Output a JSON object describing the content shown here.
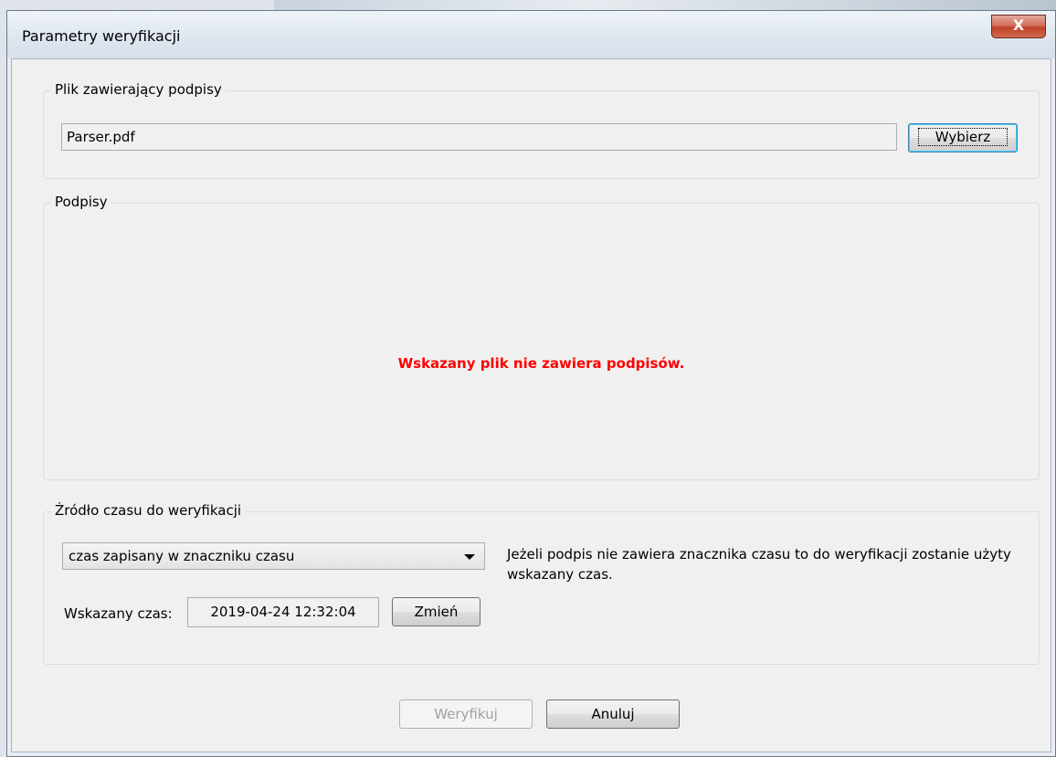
{
  "window": {
    "title": "Parametry weryfikacji",
    "close_symbol": "X"
  },
  "file_group": {
    "label": "Plik zawierający podpisy",
    "file_value": "Parser.pdf",
    "choose_label": "Wybierz"
  },
  "signatures_group": {
    "label": "Podpisy",
    "message": "Wskazany plik nie zawiera podpisów.",
    "message_color": "#ff0000"
  },
  "time_group": {
    "label": "Źródło czasu do weryfikacji",
    "source_selected": "czas zapisany w znaczniku czasu",
    "hint": "Jeżeli podpis nie zawiera znacznika czasu to do weryfikacji zostanie użyty wskazany czas.",
    "time_label": "Wskazany czas:",
    "time_value": "2019-04-24 12:32:04",
    "change_label": "Zmień"
  },
  "footer": {
    "verify_label": "Weryfikuj",
    "cancel_label": "Anuluj"
  }
}
